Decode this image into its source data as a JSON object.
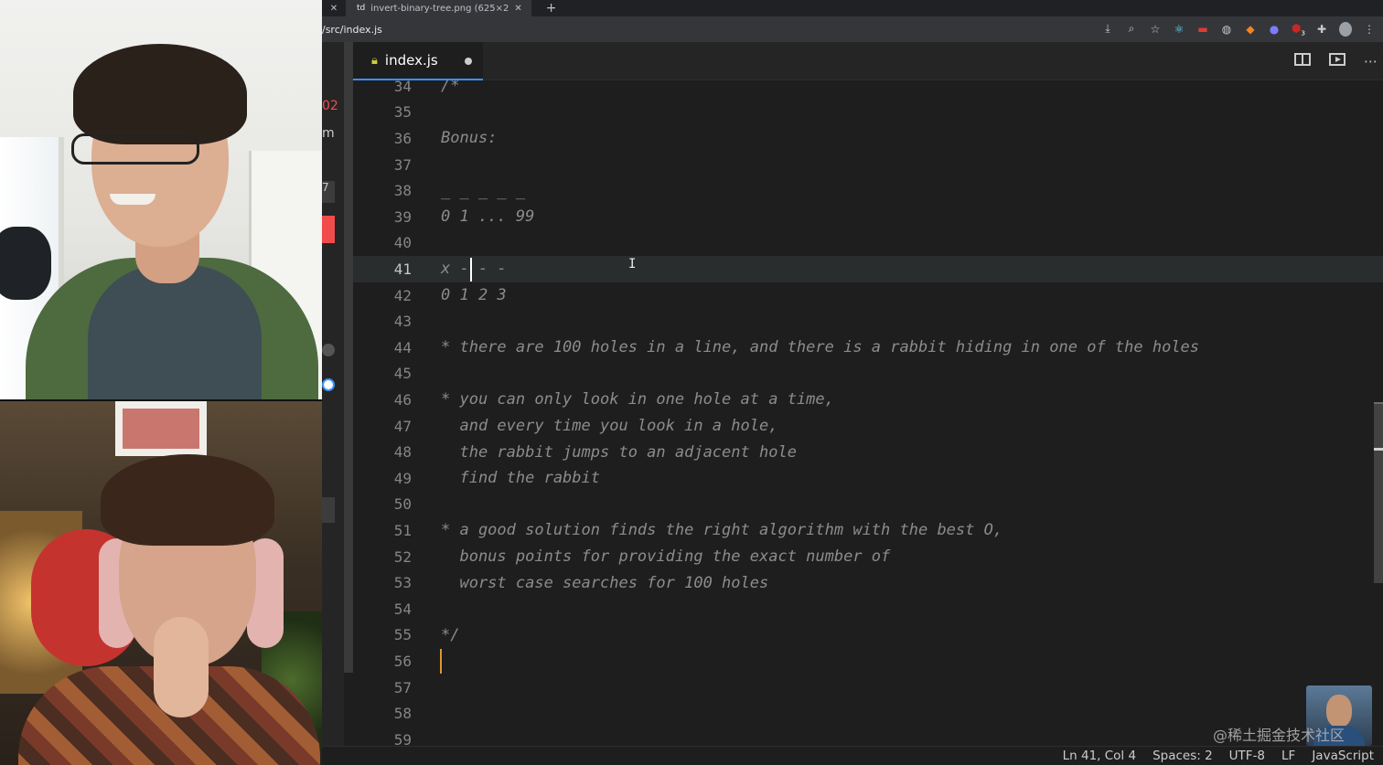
{
  "browser": {
    "tab_title": "invert-binary-tree.png (625×2",
    "tab_favicon": "td",
    "url": "/src/index.js",
    "extensions": [
      "download-icon",
      "zoom-icon",
      "star-icon",
      "react-icon",
      "ext-red-icon",
      "ext-circle-icon",
      "metamask-icon",
      "ext-blue-icon",
      "ublock-icon",
      "puzzle-icon",
      "profile-avatar",
      "kebab-menu-icon"
    ],
    "ublock_badge": "3"
  },
  "left_strip": {
    "frag1": "02",
    "frag2": "m",
    "frag3": "7"
  },
  "editor": {
    "tab_label": "index.js",
    "tab_icon": "javascript-file-icon",
    "lines": [
      {
        "n": "34",
        "text": "/*"
      },
      {
        "n": "35",
        "text": ""
      },
      {
        "n": "36",
        "text": "Bonus:"
      },
      {
        "n": "37",
        "text": ""
      },
      {
        "n": "38",
        "text": "_ _ _ _ _"
      },
      {
        "n": "39",
        "text": "0 1 ... 99"
      },
      {
        "n": "40",
        "text": ""
      },
      {
        "n": "41",
        "text": "x - - -"
      },
      {
        "n": "42",
        "text": "0 1 2 3"
      },
      {
        "n": "43",
        "text": ""
      },
      {
        "n": "44",
        "text": "* there are 100 holes in a line, and there is a rabbit hiding in one of the holes"
      },
      {
        "n": "45",
        "text": ""
      },
      {
        "n": "46",
        "text": "* you can only look in one hole at a time,"
      },
      {
        "n": "47",
        "text": "  and every time you look in a hole,"
      },
      {
        "n": "48",
        "text": "  the rabbit jumps to an adjacent hole"
      },
      {
        "n": "49",
        "text": "  find the rabbit"
      },
      {
        "n": "50",
        "text": ""
      },
      {
        "n": "51",
        "text": "* a good solution finds the right algorithm with the best O,"
      },
      {
        "n": "52",
        "text": "  bonus points for providing the exact number of"
      },
      {
        "n": "53",
        "text": "  worst case searches for 100 holes"
      },
      {
        "n": "54",
        "text": ""
      },
      {
        "n": "55",
        "text": "*/"
      },
      {
        "n": "56",
        "text": ""
      },
      {
        "n": "57",
        "text": ""
      },
      {
        "n": "58",
        "text": ""
      },
      {
        "n": "59",
        "text": ""
      }
    ]
  },
  "status": {
    "position": "Ln 41, Col 4",
    "spaces": "Spaces: 2",
    "encoding": "UTF-8",
    "eol": "LF",
    "language": "JavaScript"
  },
  "watermark": "@稀土掘金技术社区"
}
